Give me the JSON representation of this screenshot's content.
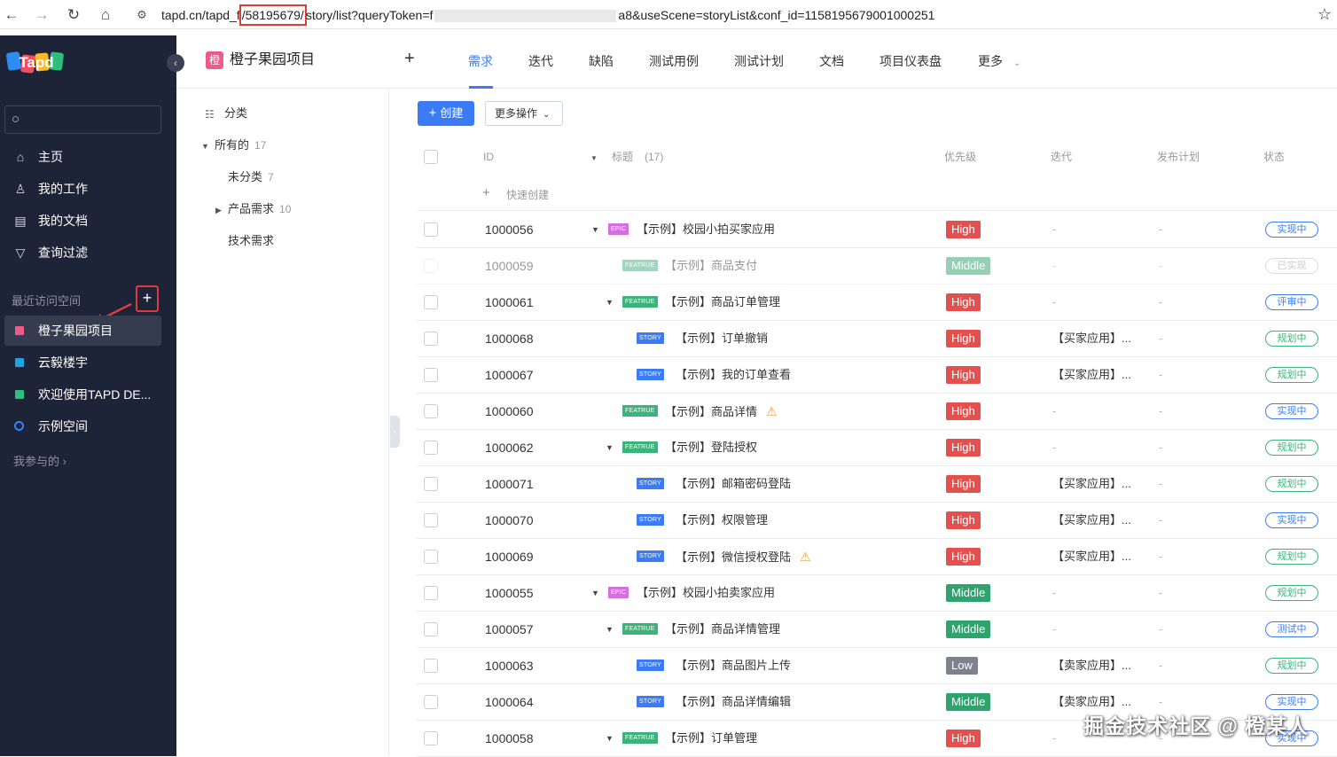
{
  "browser": {
    "back_icon": "←",
    "forward_icon": "→",
    "reload_icon": "↻",
    "home_icon": "⌂",
    "url_prefix": "tapd.cn/tapd_f",
    "url_highlight": "/58195679/",
    "url_mid": "story/list?queryToken=f",
    "url_suffix": "a8&useScene=storyList&conf_id=1158195679001000251",
    "star_icon": "☆"
  },
  "sidebar": {
    "logo": "Tapd",
    "nav": [
      {
        "label": "主页",
        "icon": "home-icon"
      },
      {
        "label": "我的工作",
        "icon": "user-icon"
      },
      {
        "label": "我的文档",
        "icon": "document-icon"
      },
      {
        "label": "查询过滤",
        "icon": "filter-icon"
      }
    ],
    "recent_title": "最近访问空间",
    "add_label": "+",
    "spaces": [
      {
        "label": "橙子果园项目",
        "color": "#f05a8a"
      },
      {
        "label": "云毅楼宇",
        "color": "#21a3e0"
      },
      {
        "label": "欢迎使用TAPD DE...",
        "color": "#2ebd7a"
      },
      {
        "label": "示例空间",
        "color": "#3b82f6"
      }
    ],
    "joined": "我参与的 ›"
  },
  "topnav": {
    "project_icon": "橙",
    "project_name": "橙子果园项目",
    "add": "+",
    "tabs": [
      "需求",
      "迭代",
      "缺陷",
      "测试用例",
      "测试计划",
      "文档",
      "项目仪表盘",
      "更多"
    ],
    "active_tab": "需求"
  },
  "tree": {
    "category": "分类",
    "all": {
      "label": "所有的",
      "count": "17"
    },
    "uncat": {
      "label": "未分类",
      "count": "7"
    },
    "product": {
      "label": "产品需求",
      "count": "10"
    },
    "tech": {
      "label": "技术需求"
    }
  },
  "toolbar": {
    "create": "创建",
    "more_ops": "更多操作"
  },
  "table": {
    "headers": {
      "id": "ID",
      "title": "标题",
      "title_count": "(17)",
      "priority": "优先级",
      "iteration": "迭代",
      "release": "发布计划",
      "status": "状态"
    },
    "quick_create": "快速创建",
    "rows": [
      {
        "id": "1000056",
        "caret": true,
        "indent": 0,
        "type": "EPIC",
        "title": "【示例】校园小拍买家应用",
        "priority": "High",
        "iteration": "-",
        "plan": "-",
        "status": "实现中",
        "status_tone": "blue",
        "warn": false,
        "dim": false
      },
      {
        "id": "1000059",
        "caret": false,
        "indent": 1,
        "type": "FEATRUE",
        "title": "【示例】商品支付",
        "priority": "Middle",
        "iteration": "-",
        "plan": "-",
        "status": "已实现",
        "status_tone": "gray",
        "warn": false,
        "dim": true
      },
      {
        "id": "1000061",
        "caret": true,
        "indent": 1,
        "type": "FEATRUE",
        "title": "【示例】商品订单管理",
        "priority": "High",
        "iteration": "-",
        "plan": "-",
        "status": "评审中",
        "status_tone": "blue",
        "warn": false,
        "dim": false
      },
      {
        "id": "1000068",
        "caret": false,
        "indent": 2,
        "type": "STORY",
        "title": "【示例】订单撤销",
        "priority": "High",
        "iteration": "【买家应用】...",
        "plan": "-",
        "status": "规划中",
        "status_tone": "green",
        "warn": false,
        "dim": false
      },
      {
        "id": "1000067",
        "caret": false,
        "indent": 2,
        "type": "STORY",
        "title": "【示例】我的订单查看",
        "priority": "High",
        "iteration": "【买家应用】...",
        "plan": "-",
        "status": "规划中",
        "status_tone": "green",
        "warn": false,
        "dim": false
      },
      {
        "id": "1000060",
        "caret": false,
        "indent": 1,
        "type": "FEATRUE",
        "title": "【示例】商品详情",
        "priority": "High",
        "iteration": "-",
        "plan": "-",
        "status": "实现中",
        "status_tone": "blue",
        "warn": true,
        "dim": false
      },
      {
        "id": "1000062",
        "caret": true,
        "indent": 1,
        "type": "FEATRUE",
        "title": "【示例】登陆授权",
        "priority": "High",
        "iteration": "-",
        "plan": "-",
        "status": "规划中",
        "status_tone": "green",
        "warn": false,
        "dim": false
      },
      {
        "id": "1000071",
        "caret": false,
        "indent": 2,
        "type": "STORY",
        "title": "【示例】邮箱密码登陆",
        "priority": "High",
        "iteration": "【买家应用】...",
        "plan": "-",
        "status": "规划中",
        "status_tone": "green",
        "warn": false,
        "dim": false
      },
      {
        "id": "1000070",
        "caret": false,
        "indent": 2,
        "type": "STORY",
        "title": "【示例】权限管理",
        "priority": "High",
        "iteration": "【买家应用】...",
        "plan": "-",
        "status": "实现中",
        "status_tone": "blue",
        "warn": false,
        "dim": false
      },
      {
        "id": "1000069",
        "caret": false,
        "indent": 2,
        "type": "STORY",
        "title": "【示例】微信授权登陆",
        "priority": "High",
        "iteration": "【买家应用】...",
        "plan": "-",
        "status": "规划中",
        "status_tone": "green",
        "warn": true,
        "dim": false
      },
      {
        "id": "1000055",
        "caret": true,
        "indent": 0,
        "type": "EPIC",
        "title": "【示例】校园小拍卖家应用",
        "priority": "Middle",
        "iteration": "-",
        "plan": "-",
        "status": "规划中",
        "status_tone": "green",
        "warn": false,
        "dim": false
      },
      {
        "id": "1000057",
        "caret": true,
        "indent": 1,
        "type": "FEATRUE",
        "title": "【示例】商品详情管理",
        "priority": "Middle",
        "iteration": "-",
        "plan": "-",
        "status": "测试中",
        "status_tone": "blue",
        "warn": false,
        "dim": false
      },
      {
        "id": "1000063",
        "caret": false,
        "indent": 2,
        "type": "STORY",
        "title": "【示例】商品图片上传",
        "priority": "Low",
        "iteration": "【卖家应用】...",
        "plan": "-",
        "status": "规划中",
        "status_tone": "green",
        "warn": false,
        "dim": false
      },
      {
        "id": "1000064",
        "caret": false,
        "indent": 2,
        "type": "STORY",
        "title": "【示例】商品详情编辑",
        "priority": "Middle",
        "iteration": "【卖家应用】...",
        "plan": "-",
        "status": "实现中",
        "status_tone": "blue",
        "warn": false,
        "dim": false
      },
      {
        "id": "1000058",
        "caret": true,
        "indent": 1,
        "type": "FEATRUE",
        "title": "【示例】订单管理",
        "priority": "High",
        "iteration": "-",
        "plan": "-",
        "status": "实现中",
        "status_tone": "blue",
        "warn": false,
        "dim": false
      }
    ]
  },
  "watermark": "掘金技术社区 @ 橙某人"
}
